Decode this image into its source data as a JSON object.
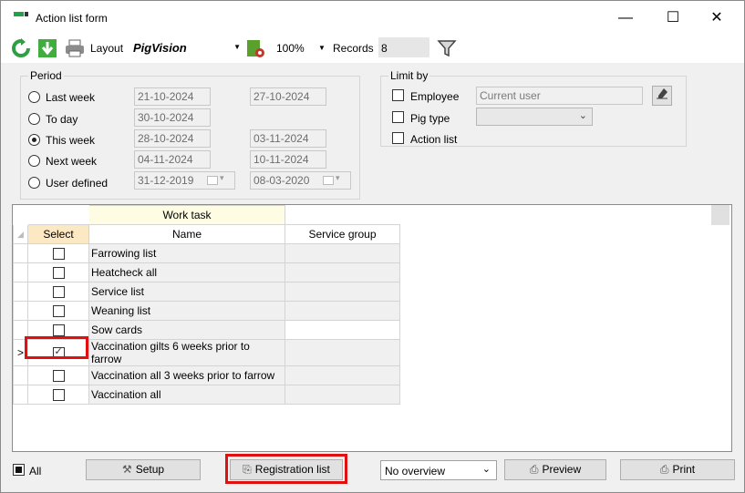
{
  "window": {
    "title": "Action list form",
    "controls": {
      "minimize": "—",
      "maximize": "☐",
      "close": "✕"
    }
  },
  "toolbar": {
    "layout_label": "Layout",
    "layout_value": "PigVision",
    "zoom_value": "100%",
    "records_label": "Records",
    "records_value": "8",
    "icons": [
      "refresh-icon",
      "download-icon",
      "printer-icon",
      "layout-settings-icon",
      "filter-icon"
    ]
  },
  "period": {
    "legend": "Period",
    "options": [
      {
        "label": "Last week",
        "from": "21-10-2024",
        "to": "27-10-2024",
        "selected": false
      },
      {
        "label": "To day",
        "from": "30-10-2024",
        "to": "",
        "selected": false
      },
      {
        "label": "This week",
        "from": "28-10-2024",
        "to": "03-11-2024",
        "selected": true
      },
      {
        "label": "Next week",
        "from": "04-11-2024",
        "to": "10-11-2024",
        "selected": false
      },
      {
        "label": "User defined",
        "from": "31-12-2019",
        "to": "08-03-2020",
        "selected": false
      }
    ]
  },
  "limit_by": {
    "legend": "Limit by",
    "employee_label": "Employee",
    "employee_placeholder": "Current user",
    "pig_type_label": "Pig type",
    "action_list_label": "Action list"
  },
  "grid": {
    "band_header": "Work task",
    "col_select": "Select",
    "col_name": "Name",
    "col_service_group": "Service group",
    "rows": [
      {
        "name": "Farrowing list",
        "checked": false,
        "current": false
      },
      {
        "name": "Heatcheck all",
        "checked": false,
        "current": false
      },
      {
        "name": "Service list",
        "checked": false,
        "current": false
      },
      {
        "name": "Weaning list",
        "checked": false,
        "current": false
      },
      {
        "name": "Sow cards",
        "checked": false,
        "current": false
      },
      {
        "name": "Vaccination gilts 6 weeks prior to farrow",
        "checked": true,
        "current": true
      },
      {
        "name": "Vaccination all 3 weeks prior to farrow",
        "checked": false,
        "current": false
      },
      {
        "name": "Vaccination all",
        "checked": false,
        "current": false
      }
    ],
    "current_row_marker": ">"
  },
  "bottom": {
    "all_label": "All",
    "setup_label": "Setup",
    "registration_label": "Registration list",
    "overview_value": "No overview",
    "preview_label": "Preview",
    "print_label": "Print"
  },
  "colors": {
    "highlight": "#e01010",
    "band_header": "#fefce2",
    "select_header": "#fde8c4"
  }
}
